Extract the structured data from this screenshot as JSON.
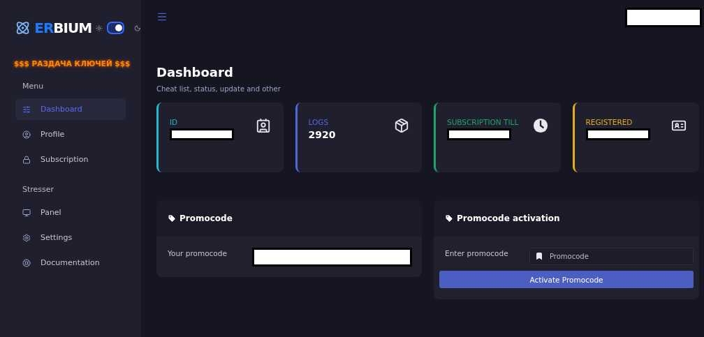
{
  "logo": {
    "accent": "ER",
    "rest": "BIUM"
  },
  "theme_toggle": {
    "on": true
  },
  "promo_banner": "$$$ РАЗДАЧА КЛЮЧЕЙ $$$",
  "sidebar": {
    "items": [
      {
        "kind": "header",
        "label": "Menu"
      },
      {
        "kind": "link",
        "label": "Dashboard",
        "selected": true
      },
      {
        "kind": "link",
        "label": "Profile",
        "selected": false
      },
      {
        "kind": "link",
        "label": "Subscription",
        "selected": false
      },
      {
        "kind": "header",
        "label": "Stresser"
      },
      {
        "kind": "link",
        "label": "Panel",
        "selected": false
      },
      {
        "kind": "link",
        "label": "Settings",
        "selected": false
      },
      {
        "kind": "link",
        "label": "Documentation",
        "selected": false
      }
    ]
  },
  "topbar": {
    "user_redacted": true
  },
  "page": {
    "title": "Dashboard",
    "subtitle": "Cheat list, status, update and other"
  },
  "stats": [
    {
      "label": "ID",
      "redacted": true,
      "color": "#22b8cf"
    },
    {
      "label": "LOGS",
      "value": "2920",
      "redacted": false,
      "color": "#4e6bdc"
    },
    {
      "label": "SUBSCRIPTION TILL",
      "redacted": true,
      "color": "#1fa36a"
    },
    {
      "label": "REGISTERED",
      "redacted": true,
      "color": "#e6ad1c"
    }
  ],
  "promocode": {
    "title": "Promocode",
    "label": "Your promocode",
    "redacted": true
  },
  "activation": {
    "title": "Promocode activation",
    "label": "Enter promocode",
    "placeholder": "Promocode",
    "button": "Activate Promocode"
  }
}
